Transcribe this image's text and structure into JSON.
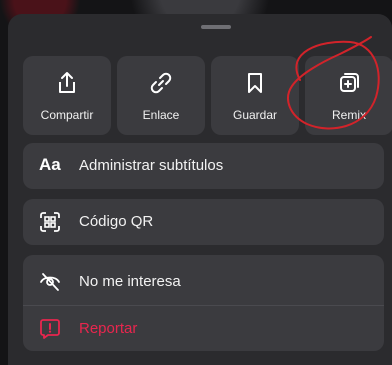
{
  "tiles": [
    {
      "label": "Compartir",
      "icon": "share-icon"
    },
    {
      "label": "Enlace",
      "icon": "link-icon"
    },
    {
      "label": "Guardar",
      "icon": "bookmark-icon"
    },
    {
      "label": "Remix",
      "icon": "remix-icon"
    }
  ],
  "menu": {
    "subtitles": {
      "label": "Administrar subtítulos",
      "icon": "captions-icon"
    },
    "qr": {
      "label": "Código QR",
      "icon": "qr-code-icon"
    },
    "not_interested": {
      "label": "No me interesa",
      "icon": "eye-slash-icon"
    },
    "report": {
      "label": "Reportar",
      "icon": "report-icon"
    }
  },
  "icons": {
    "captions_glyph": "Aa"
  },
  "colors": {
    "sheet": "#2b2b2e",
    "tile": "#3b3b3f",
    "report_red": "#e8264e",
    "annotation_red": "#d2232a"
  }
}
